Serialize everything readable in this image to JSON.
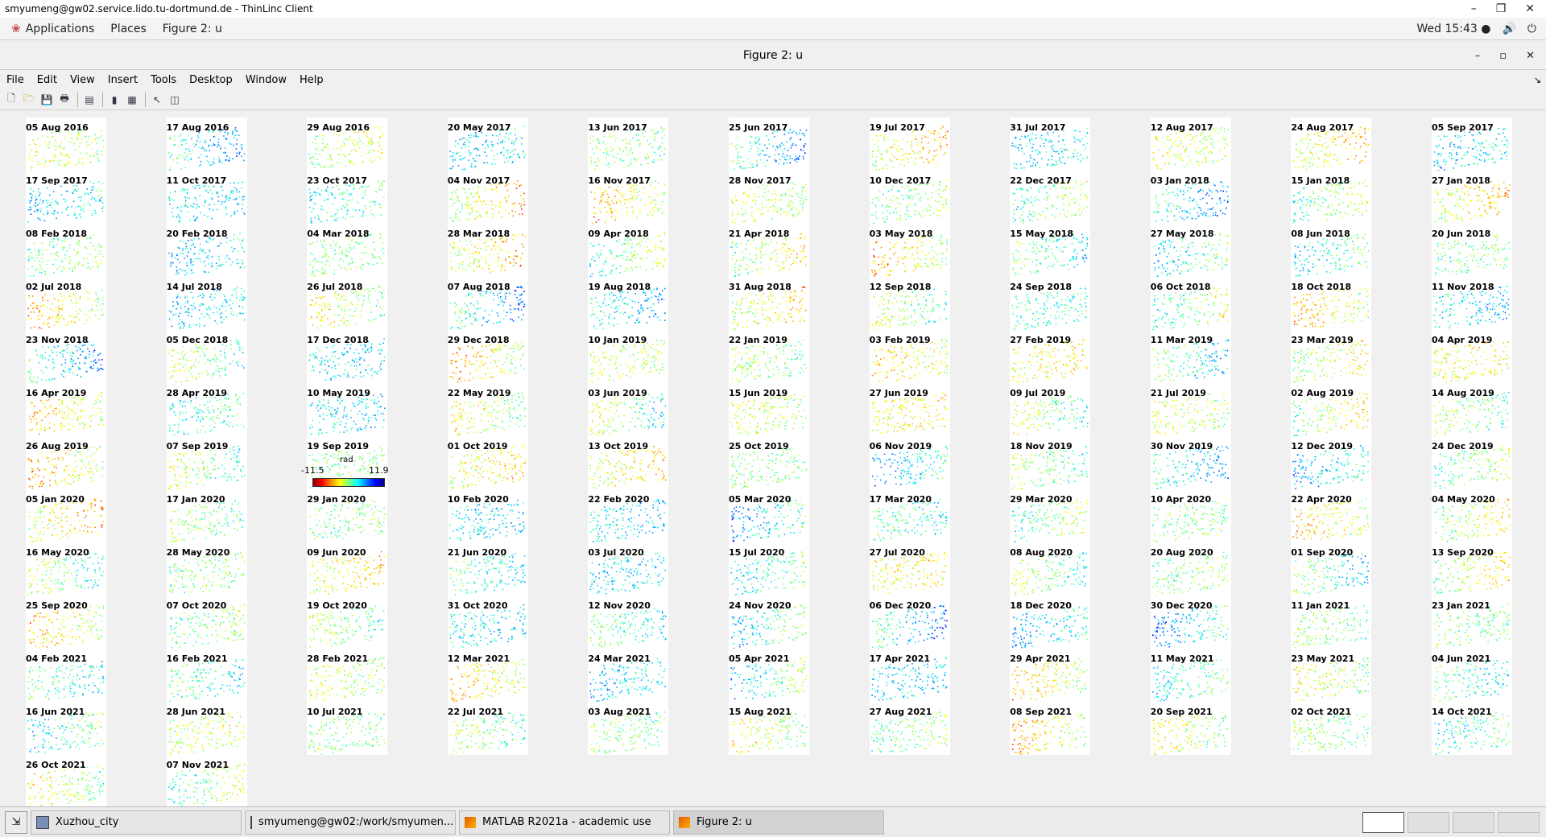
{
  "client_title": "smyumeng@gw02.service.lido.tu-dortmund.de - ThinLinc Client",
  "panel": {
    "menus": [
      "Applications",
      "Places",
      "Figure 2: u"
    ],
    "clock": "Wed 15:43 ●"
  },
  "figure_title": "Figure 2: u",
  "menu": [
    "File",
    "Edit",
    "View",
    "Insert",
    "Tools",
    "Desktop",
    "Window",
    "Help"
  ],
  "toolbar_icons": [
    "new-figure-icon",
    "open-file-icon",
    "save-icon",
    "print-icon",
    "print-preview-icon",
    "colorbar-icon",
    "legend-icon",
    "pointer-icon",
    "plot-browser-icon"
  ],
  "colorbar": {
    "unit": "rad",
    "min": "-11.5",
    "max": "11.9"
  },
  "dates": [
    "05 Aug 2016",
    "17 Aug 2016",
    "29 Aug 2016",
    "20 May 2017",
    "13 Jun 2017",
    "25 Jun 2017",
    "19 Jul 2017",
    "31 Jul 2017",
    "12 Aug 2017",
    "24 Aug 2017",
    "05 Sep 2017",
    "17 Sep 2017",
    "11 Oct 2017",
    "23 Oct 2017",
    "04 Nov 2017",
    "16 Nov 2017",
    "28 Nov 2017",
    "10 Dec 2017",
    "22 Dec 2017",
    "03 Jan 2018",
    "15 Jan 2018",
    "27 Jan 2018",
    "08 Feb 2018",
    "20 Feb 2018",
    "04 Mar 2018",
    "28 Mar 2018",
    "09 Apr 2018",
    "21 Apr 2018",
    "03 May 2018",
    "15 May 2018",
    "27 May 2018",
    "08 Jun 2018",
    "20 Jun 2018",
    "02 Jul 2018",
    "14 Jul 2018",
    "26 Jul 2018",
    "07 Aug 2018",
    "19 Aug 2018",
    "31 Aug 2018",
    "12 Sep 2018",
    "24 Sep 2018",
    "06 Oct 2018",
    "18 Oct 2018",
    "11 Nov 2018",
    "23 Nov 2018",
    "05 Dec 2018",
    "17 Dec 2018",
    "29 Dec 2018",
    "10 Jan 2019",
    "22 Jan 2019",
    "03 Feb 2019",
    "27 Feb 2019",
    "11 Mar 2019",
    "23 Mar 2019",
    "04 Apr 2019",
    "16 Apr 2019",
    "28 Apr 2019",
    "10 May 2019",
    "22 May 2019",
    "03 Jun 2019",
    "15 Jun 2019",
    "27 Jun 2019",
    "09 Jul 2019",
    "21 Jul 2019",
    "02 Aug 2019",
    "14 Aug 2019",
    "26 Aug 2019",
    "07 Sep 2019",
    "19 Sep 2019",
    "01 Oct 2019",
    "13 Oct 2019",
    "25 Oct 2019",
    "06 Nov 2019",
    "18 Nov 2019",
    "30 Nov 2019",
    "12 Dec 2019",
    "24 Dec 2019",
    "05 Jan 2020",
    "17 Jan 2020",
    "29 Jan 2020",
    "10 Feb 2020",
    "22 Feb 2020",
    "05 Mar 2020",
    "17 Mar 2020",
    "29 Mar 2020",
    "10 Apr 2020",
    "22 Apr 2020",
    "04 May 2020",
    "16 May 2020",
    "28 May 2020",
    "09 Jun 2020",
    "21 Jun 2020",
    "03 Jul 2020",
    "15 Jul 2020",
    "27 Jul 2020",
    "08 Aug 2020",
    "20 Aug 2020",
    "01 Sep 2020",
    "13 Sep 2020",
    "25 Sep 2020",
    "07 Oct 2020",
    "19 Oct 2020",
    "31 Oct 2020",
    "12 Nov 2020",
    "24 Nov 2020",
    "06 Dec 2020",
    "18 Dec 2020",
    "30 Dec 2020",
    "11 Jan 2021",
    "23 Jan 2021",
    "04 Feb 2021",
    "16 Feb 2021",
    "28 Feb 2021",
    "12 Mar 2021",
    "24 Mar 2021",
    "05 Apr 2021",
    "17 Apr 2021",
    "29 Apr 2021",
    "11 May 2021",
    "23 May 2021",
    "04 Jun 2021",
    "16 Jun 2021",
    "28 Jun 2021",
    "10 Jul 2021",
    "22 Jul 2021",
    "03 Aug 2021",
    "15 Aug 2021",
    "27 Aug 2021",
    "08 Sep 2021",
    "20 Sep 2021",
    "02 Oct 2021",
    "14 Oct 2021",
    "26 Oct 2021",
    "07 Nov 2021"
  ],
  "taskbar": [
    {
      "label": "Xuzhou_city",
      "icon": "folder-icon"
    },
    {
      "label": "smyumeng@gw02:/work/smyumen...",
      "icon": "terminal-icon"
    },
    {
      "label": "MATLAB R2021a - academic use",
      "icon": "matlab-icon"
    },
    {
      "label": "Figure 2: u",
      "icon": "matlab-figure-icon"
    }
  ]
}
